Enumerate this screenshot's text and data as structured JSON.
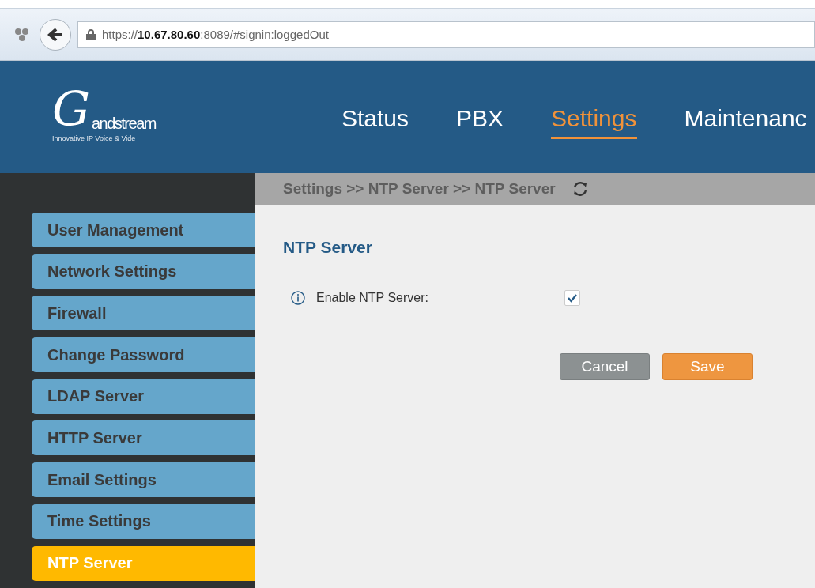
{
  "browser": {
    "url": "https://**10.67.80.60**:8089/#signin:loggedOut"
  },
  "logo": {
    "mark": "G",
    "wordmark": "andstream",
    "tagline": "Innovative IP Voice & Vide"
  },
  "nav": [
    {
      "label": "Status",
      "selected": false
    },
    {
      "label": "PBX",
      "selected": false
    },
    {
      "label": "Settings",
      "selected": true
    },
    {
      "label": "Maintenanc",
      "selected": false
    }
  ],
  "sidebar": {
    "items": [
      {
        "label": "User Management",
        "selected": false
      },
      {
        "label": "Network Settings",
        "selected": false
      },
      {
        "label": "Firewall",
        "selected": false
      },
      {
        "label": "Change Password",
        "selected": false
      },
      {
        "label": "LDAP Server",
        "selected": false
      },
      {
        "label": "HTTP Server",
        "selected": false
      },
      {
        "label": "Email Settings",
        "selected": false
      },
      {
        "label": "Time Settings",
        "selected": false
      },
      {
        "label": "NTP Server",
        "selected": true
      }
    ]
  },
  "breadcrumb": "Settings >> NTP Server >> NTP Server",
  "section": {
    "title": "NTP Server",
    "fields": [
      {
        "label": "Enable NTP Server:",
        "checked": true
      }
    ]
  },
  "buttons": [
    {
      "label": "Cancel",
      "kind": "secondary"
    },
    {
      "label": "Save",
      "kind": "primary"
    }
  ]
}
